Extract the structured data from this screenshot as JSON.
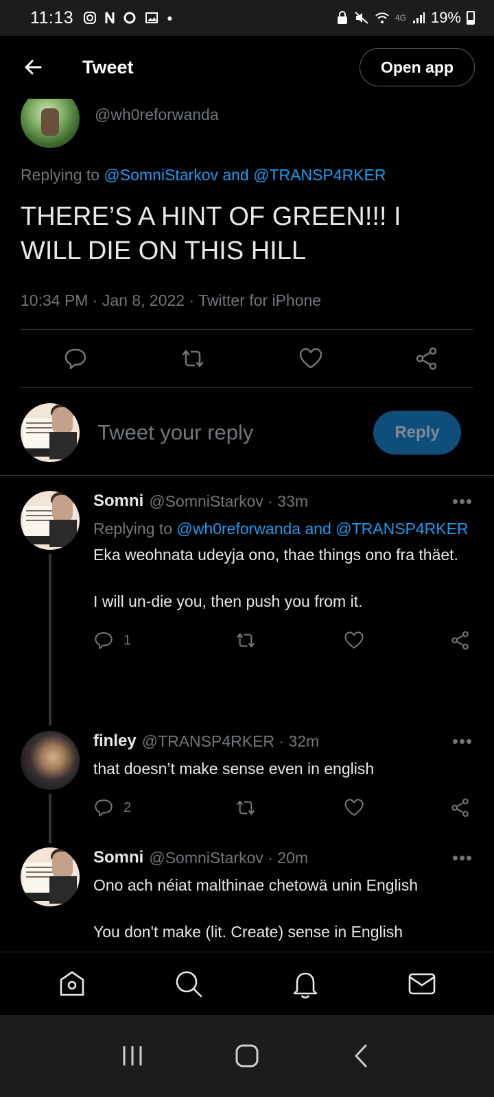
{
  "status_bar": {
    "time": "11:13",
    "network": "4G",
    "battery_percent": "19%"
  },
  "header": {
    "title": "Tweet",
    "open_app_label": "Open app"
  },
  "main_tweet": {
    "handle": "@wh0reforwanda",
    "replying_prefix": "Replying to",
    "replying_mentions": "@SomniStarkov and @TRANSP4RKER",
    "text": "THERE’S A HINT OF GREEN!!! I WILL DIE ON THIS HILL",
    "meta": "10:34 PM · Jan 8, 2022 · Twitter for iPhone"
  },
  "reply_box": {
    "placeholder": "Tweet your reply",
    "button_label": "Reply"
  },
  "replies": [
    {
      "name": "Somni",
      "handle": "@SomniStarkov · 33m",
      "replying_prefix": "Replying to",
      "replying_mentions": "@wh0reforwanda and @TRANSP4RKER",
      "text": "Eka weohnata udeyja ono, thae things ono fra thäet.\n\nI will un-die you, then push you from it.",
      "reply_count": "1"
    },
    {
      "name": "finley",
      "handle": "@TRANSP4RKER · 32m",
      "text": "that doesn’t make sense even in english",
      "reply_count": "2"
    },
    {
      "name": "Somni",
      "handle": "@SomniStarkov · 20m",
      "text": "Ono ach néiat malthinae chetowä unin English\n\nYou don't make (lit. Create) sense in English"
    }
  ],
  "more_label": "•••",
  "colors": {
    "background": "#000000",
    "accent": "#1d9bf0",
    "secondary_text": "#71767b",
    "reply_button_disabled": "#0f4e7a"
  }
}
